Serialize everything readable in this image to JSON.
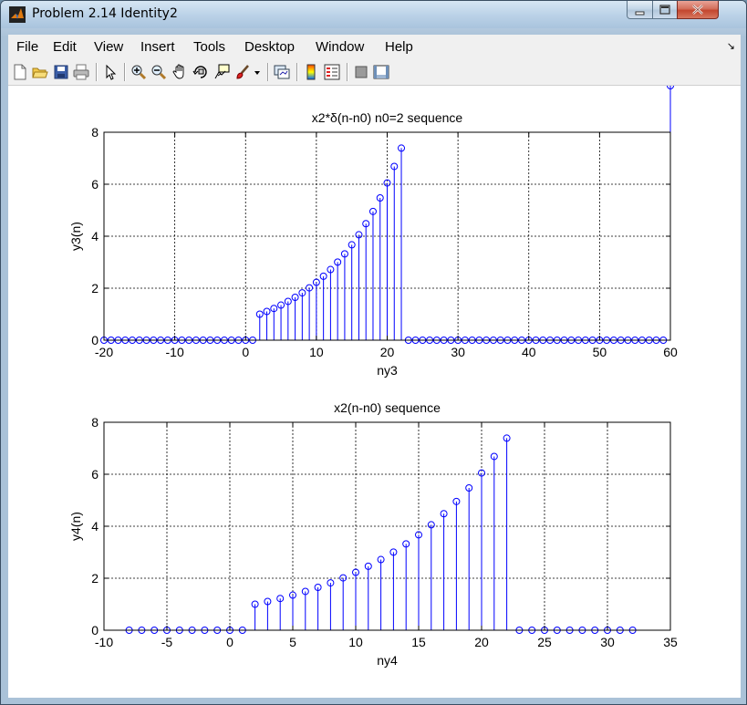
{
  "window": {
    "title": "Problem 2.14 Identity2"
  },
  "menu": {
    "items": [
      "File",
      "Edit",
      "View",
      "Insert",
      "Tools",
      "Desktop",
      "Window",
      "Help"
    ],
    "dock_arrow": "↘"
  },
  "toolbar": {
    "icons": [
      "new-figure-icon",
      "open-file-icon",
      "save-icon",
      "print-icon",
      "edit-plot-arrow-icon",
      "zoom-in-icon",
      "zoom-out-icon",
      "pan-hand-icon",
      "rotate-3d-icon",
      "data-cursor-icon",
      "brush-icon",
      "brush-dropdown-icon",
      "link-plot-icon",
      "insert-colorbar-icon",
      "insert-legend-icon",
      "hide-plot-tools-icon",
      "show-plot-tools-icon"
    ]
  },
  "colors": {
    "stem": "#0000ff",
    "axes": "#000000",
    "grid": "#000000",
    "background": "#ffffff"
  },
  "chart_data": [
    {
      "type": "stem",
      "title": "x2*δ(n-n0) n0=2 sequence",
      "xlabel": "ny3",
      "ylabel": "y3(n)",
      "xlim": [
        -20,
        60
      ],
      "ylim": [
        0,
        8
      ],
      "xticks": [
        -20,
        -10,
        0,
        10,
        20,
        30,
        40,
        50,
        60
      ],
      "yticks": [
        0,
        2,
        4,
        6,
        8
      ],
      "grid": true,
      "x": [
        -20,
        -19,
        -18,
        -17,
        -16,
        -15,
        -14,
        -13,
        -12,
        -11,
        -10,
        -9,
        -8,
        -7,
        -6,
        -5,
        -4,
        -3,
        -2,
        -1,
        0,
        1,
        2,
        3,
        4,
        5,
        6,
        7,
        8,
        9,
        10,
        11,
        12,
        13,
        14,
        15,
        16,
        17,
        18,
        19,
        20,
        21,
        22,
        23,
        24,
        25,
        26,
        27,
        28,
        29,
        30,
        31,
        32,
        33,
        34,
        35,
        36,
        37,
        38,
        39,
        40,
        41,
        42,
        43,
        44,
        45,
        46,
        47,
        48,
        49,
        50,
        51,
        52,
        53,
        54,
        55,
        56,
        57,
        58,
        59,
        60
      ],
      "y": [
        0,
        0,
        0,
        0,
        0,
        0,
        0,
        0,
        0,
        0,
        0,
        0,
        0,
        0,
        0,
        0,
        0,
        0,
        0,
        0,
        0,
        0,
        1.0,
        1.105,
        1.221,
        1.35,
        1.492,
        1.649,
        1.822,
        2.014,
        2.226,
        2.46,
        2.718,
        3.004,
        3.32,
        3.669,
        4.055,
        4.482,
        4.953,
        5.474,
        6.05,
        6.686,
        7.389,
        0,
        0,
        0,
        0,
        0,
        0,
        0,
        0,
        0,
        0,
        0,
        0,
        0,
        0,
        0,
        0,
        0,
        0,
        0,
        0,
        0,
        0,
        0,
        0,
        0,
        0,
        0,
        0,
        0,
        0,
        0,
        0,
        0,
        0,
        0,
        0,
        0
      ]
    },
    {
      "type": "stem",
      "title": "x2(n-n0) sequence",
      "xlabel": "ny4",
      "ylabel": "y4(n)",
      "xlim": [
        -10,
        35
      ],
      "ylim": [
        0,
        8
      ],
      "xticks": [
        -10,
        -5,
        0,
        5,
        10,
        15,
        20,
        25,
        30,
        35
      ],
      "yticks": [
        0,
        2,
        4,
        6,
        8
      ],
      "grid": true,
      "x": [
        -8,
        -7,
        -6,
        -5,
        -4,
        -3,
        -2,
        -1,
        0,
        1,
        2,
        3,
        4,
        5,
        6,
        7,
        8,
        9,
        10,
        11,
        12,
        13,
        14,
        15,
        16,
        17,
        18,
        19,
        20,
        21,
        22,
        23,
        24,
        25,
        26,
        27,
        28,
        29,
        30,
        31,
        32
      ],
      "y": [
        0,
        0,
        0,
        0,
        0,
        0,
        0,
        0,
        0,
        0,
        1.0,
        1.105,
        1.221,
        1.35,
        1.492,
        1.649,
        1.822,
        2.014,
        2.226,
        2.46,
        2.718,
        3.004,
        3.32,
        3.669,
        4.055,
        4.482,
        4.953,
        5.474,
        6.05,
        6.686,
        7.389,
        0,
        0,
        0,
        0,
        0,
        0,
        0,
        0,
        0,
        0
      ]
    }
  ]
}
